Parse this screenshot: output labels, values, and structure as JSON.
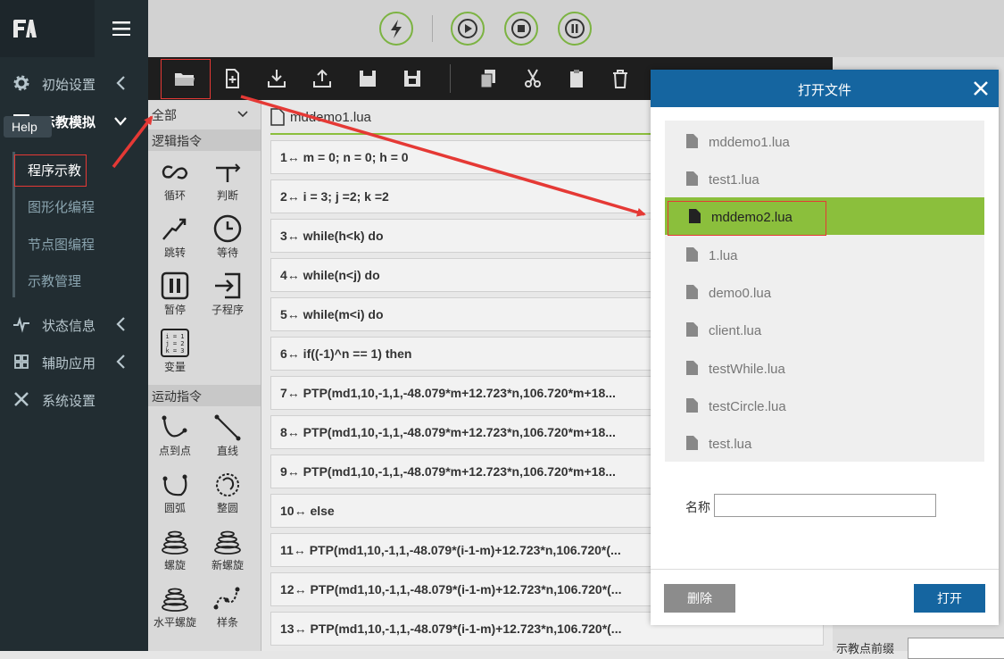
{
  "sidebar": {
    "logo": "logo",
    "help_label": "Help",
    "items": [
      {
        "label": "初始设置",
        "icon": "gear-icon"
      },
      {
        "label": "示教模拟",
        "icon": "teach-icon"
      },
      {
        "label": "状态信息",
        "icon": "pulse-icon"
      },
      {
        "label": "辅助应用",
        "icon": "grid-icon"
      },
      {
        "label": "系统设置",
        "icon": "tools-icon"
      }
    ],
    "sub_items": [
      "程序示教",
      "图形化编程",
      "节点图编程",
      "示教管理"
    ]
  },
  "top_controls": [
    "power-icon",
    "play-icon",
    "stop-icon",
    "pause-icon"
  ],
  "toolbar": [
    "open-folder-icon",
    "new-file-icon",
    "download-icon",
    "upload-icon",
    "save-icon",
    "save-as-icon",
    "copy-icon",
    "cut-icon",
    "paste-icon",
    "delete-icon"
  ],
  "cmd_panel": {
    "filter": "全部",
    "logic_title": "逻辑指令",
    "logic": [
      "循环",
      "判断",
      "跳转",
      "等待",
      "暂停",
      "子程序",
      "变量"
    ],
    "motion_title": "运动指令",
    "motion": [
      "点到点",
      "直线",
      "圆弧",
      "整圆",
      "螺旋",
      "新螺旋",
      "水平螺旋",
      "样条"
    ]
  },
  "editor": {
    "filename": "mddemo1.lua",
    "lines": [
      "1↔ m = 0; n = 0; h = 0",
      "2↔ i = 3; j =2; k =2",
      "3↔ while(h<k) do",
      "4↔ while(n<j) do",
      "5↔ while(m<i) do",
      "6↔ if((-1)^n == 1) then",
      "7↔ PTP(md1,10,-1,1,-48.079*m+12.723*n,106.720*m+18...",
      "8↔ PTP(md1,10,-1,1,-48.079*m+12.723*n,106.720*m+18...",
      "9↔ PTP(md1,10,-1,1,-48.079*m+12.723*n,106.720*m+18...",
      "10↔ else",
      "11↔ PTP(md1,10,-1,1,-48.079*(i-1-m)+12.723*n,106.720*(...",
      "12↔ PTP(md1,10,-1,1,-48.079*(i-1-m)+12.723*n,106.720*(...",
      "13↔ PTP(md1,10,-1,1,-48.079*(i-1-m)+12.723*n,106.720*(..."
    ]
  },
  "right_partial": {
    "label": "示教点前缀"
  },
  "dialog": {
    "title": "打开文件",
    "files": [
      "mddemo1.lua",
      "test1.lua",
      "mddemo2.lua",
      "1.lua",
      "demo0.lua",
      "client.lua",
      "testWhile.lua",
      "testCircle.lua",
      "test.lua"
    ],
    "selected": "mddemo2.lua",
    "name_label": "名称",
    "name_value": "",
    "delete_label": "删除",
    "open_label": "打开"
  },
  "colors": {
    "accent": "#1565a0",
    "selected": "#8bbf3c",
    "annotation": "#e53935",
    "control": "#7cb342"
  }
}
